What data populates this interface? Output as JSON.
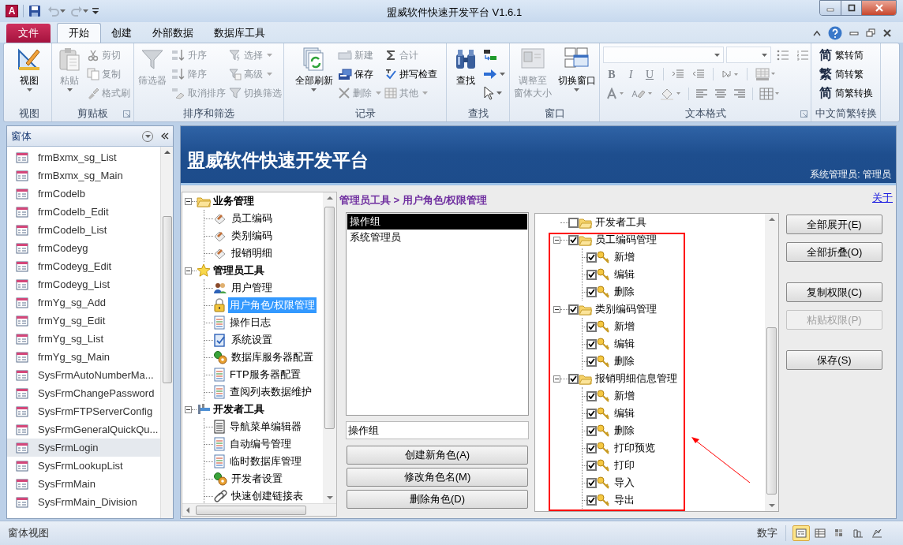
{
  "window": {
    "app_logo": "A",
    "title": "盟威软件快速开发平台 V1.6.1"
  },
  "ribbon_tabs": [
    {
      "label": "文件",
      "kind": "file",
      "selected": false
    },
    {
      "label": "开始",
      "kind": "tab",
      "selected": true
    },
    {
      "label": "创建",
      "kind": "tab",
      "selected": false
    },
    {
      "label": "外部数据",
      "kind": "tab",
      "selected": false
    },
    {
      "label": "数据库工具",
      "kind": "tab",
      "selected": false
    }
  ],
  "ribbon_groups": [
    {
      "label": "视图",
      "columns": [
        [
          {
            "kind": "large",
            "label_lines": [
              "视图"
            ],
            "disabled": false,
            "dropdown": true
          }
        ]
      ]
    },
    {
      "label": "剪贴板",
      "launcher": true,
      "columns": [
        [
          {
            "kind": "large",
            "label_lines": [
              "粘贴"
            ],
            "disabled": true,
            "dropdown": true
          }
        ],
        [
          {
            "kind": "small",
            "label": "剪切",
            "disabled": true
          },
          {
            "kind": "small",
            "label": "复制",
            "disabled": true
          },
          {
            "kind": "small",
            "label": "格式刷",
            "disabled": true
          }
        ]
      ]
    },
    {
      "label": "排序和筛选",
      "columns": [
        [
          {
            "kind": "large",
            "label_lines": [
              "筛选器"
            ],
            "disabled": true
          }
        ],
        [
          {
            "kind": "small",
            "label": "升序",
            "disabled": true
          },
          {
            "kind": "small",
            "label": "降序",
            "disabled": true
          },
          {
            "kind": "small",
            "label": "取消排序",
            "disabled": true
          }
        ],
        [
          {
            "kind": "small",
            "label": "选择",
            "disabled": true,
            "dropdown": true
          },
          {
            "kind": "small",
            "label": "高级",
            "disabled": true,
            "dropdown": true
          },
          {
            "kind": "small",
            "label": "切换筛选",
            "disabled": true
          }
        ]
      ]
    },
    {
      "label": "记录",
      "columns": [
        [
          {
            "kind": "large",
            "label_lines": [
              "全部刷新"
            ],
            "disabled": false,
            "dropdown": true
          }
        ],
        [
          {
            "kind": "small",
            "label": "新建",
            "disabled": true
          },
          {
            "kind": "small",
            "label": "保存",
            "disabled": false
          },
          {
            "kind": "small",
            "label": "删除",
            "disabled": true,
            "dropdown": true
          }
        ],
        [
          {
            "kind": "small",
            "label": "合计",
            "disabled": true
          },
          {
            "kind": "small",
            "label": "拼写检查",
            "disabled": false
          },
          {
            "kind": "small",
            "label": "其他",
            "disabled": true,
            "dropdown": true
          }
        ]
      ]
    },
    {
      "label": "查找",
      "columns": [
        [
          {
            "kind": "large",
            "label_lines": [
              "查找"
            ],
            "disabled": false
          }
        ],
        [
          {
            "kind": "icon",
            "disabled": false
          },
          {
            "kind": "icon",
            "disabled": false,
            "dropdown": true
          },
          {
            "kind": "icon",
            "disabled": false,
            "dropdown": true
          }
        ]
      ]
    },
    {
      "label": "窗口",
      "columns": [
        [
          {
            "kind": "large",
            "label_lines": [
              "调整至",
              "窗体大小"
            ],
            "disabled": true
          }
        ],
        [
          {
            "kind": "large",
            "label_lines": [
              "切换窗口"
            ],
            "disabled": false,
            "dropdown": true
          }
        ]
      ]
    },
    {
      "label": "文本格式",
      "launcher": true,
      "kind": "text_format",
      "glyphs": [
        "B",
        "I",
        "U"
      ]
    },
    {
      "label": "中文简繁转换",
      "columns": [
        [
          {
            "kind": "glyph",
            "glyph": "简",
            "label": "繁转简",
            "disabled": false
          },
          {
            "kind": "glyph",
            "glyph": "繁",
            "label": "简转繁",
            "disabled": false
          },
          {
            "kind": "glyph",
            "glyph": "简",
            "label": "简繁转换",
            "disabled": false
          }
        ]
      ]
    }
  ],
  "navigation_pane": {
    "title": "窗体",
    "items": [
      {
        "label": "frmBxmx_sg_List",
        "selected": false
      },
      {
        "label": "frmBxmx_sg_Main",
        "selected": false
      },
      {
        "label": "frmCodelb",
        "selected": false
      },
      {
        "label": "frmCodelb_Edit",
        "selected": false
      },
      {
        "label": "frmCodelb_List",
        "selected": false
      },
      {
        "label": "frmCodeyg",
        "selected": false
      },
      {
        "label": "frmCodeyg_Edit",
        "selected": false
      },
      {
        "label": "frmCodeyg_List",
        "selected": false
      },
      {
        "label": "frmYg_sg_Add",
        "selected": false
      },
      {
        "label": "frmYg_sg_Edit",
        "selected": false
      },
      {
        "label": "frmYg_sg_List",
        "selected": false
      },
      {
        "label": "frmYg_sg_Main",
        "selected": false
      },
      {
        "label": "SysFrmAutoNumberMa...",
        "selected": false
      },
      {
        "label": "SysFrmChangePassword",
        "selected": false
      },
      {
        "label": "SysFrmFTPServerConfig",
        "selected": false
      },
      {
        "label": "SysFrmGeneralQuickQu...",
        "selected": false
      },
      {
        "label": "SysFrmLogin",
        "selected": true
      },
      {
        "label": "SysFrmLookupList",
        "selected": false
      },
      {
        "label": "SysFrmMain",
        "selected": false
      },
      {
        "label": "SysFrmMain_Division",
        "selected": false
      }
    ]
  },
  "form_header": {
    "title": "盟威软件快速开发平台",
    "user": "系统管理员: 管理员"
  },
  "about_link": "关于",
  "breadcrumb": "管理员工具 > 用户角色/权限管理",
  "menu_tree": [
    {
      "label": "业务管理",
      "expanded": true,
      "selected": false,
      "children": [
        {
          "label": "员工编码",
          "selected": false
        },
        {
          "label": "类别编码",
          "selected": false
        },
        {
          "label": "报销明细",
          "selected": false
        }
      ]
    },
    {
      "label": "管理员工具",
      "expanded": true,
      "selected": false,
      "children": [
        {
          "label": "用户管理",
          "selected": false
        },
        {
          "label": "用户角色/权限管理",
          "selected": true
        },
        {
          "label": "操作日志",
          "selected": false
        },
        {
          "label": "系统设置",
          "selected": false
        },
        {
          "label": "数据库服务器配置",
          "selected": false
        },
        {
          "label": "FTP服务器配置",
          "selected": false
        },
        {
          "label": "查阅列表数据维护",
          "selected": false
        }
      ]
    },
    {
      "label": "开发者工具",
      "expanded": true,
      "selected": false,
      "children": [
        {
          "label": "导航菜单编辑器",
          "selected": false
        },
        {
          "label": "自动编号管理",
          "selected": false
        },
        {
          "label": "临时数据库管理",
          "selected": false
        },
        {
          "label": "开发者设置",
          "selected": false
        },
        {
          "label": "快速创建链接表",
          "selected": false
        }
      ]
    }
  ],
  "roles": {
    "items": [
      {
        "label": "操作组",
        "selected": true
      },
      {
        "label": "系统管理员",
        "selected": false
      }
    ],
    "role_name": "操作组",
    "buttons": [
      "创建新角色(A)",
      "修改角色名(M)",
      "删除角色(D)"
    ]
  },
  "permission_tree": [
    {
      "label": "开发者工具",
      "checked": false
    },
    {
      "label": "员工编码管理",
      "checked": true,
      "expanded": true,
      "children": [
        {
          "label": "新增",
          "checked": true
        },
        {
          "label": "编辑",
          "checked": true
        },
        {
          "label": "删除",
          "checked": true
        }
      ]
    },
    {
      "label": "类别编码管理",
      "checked": true,
      "expanded": true,
      "children": [
        {
          "label": "新增",
          "checked": true
        },
        {
          "label": "编辑",
          "checked": true
        },
        {
          "label": "删除",
          "checked": true
        }
      ]
    },
    {
      "label": "报销明细信息管理",
      "checked": true,
      "expanded": true,
      "children": [
        {
          "label": "新增",
          "checked": true
        },
        {
          "label": "编辑",
          "checked": true
        },
        {
          "label": "删除",
          "checked": true
        },
        {
          "label": "打印预览",
          "checked": true
        },
        {
          "label": "打印",
          "checked": true
        },
        {
          "label": "导入",
          "checked": true
        },
        {
          "label": "导出",
          "checked": true
        }
      ]
    }
  ],
  "permission_buttons": [
    {
      "label": "全部展开(E)",
      "disabled": false
    },
    {
      "label": "全部折叠(O)",
      "disabled": false
    },
    {
      "label": "复制权限(C)",
      "disabled": false
    },
    {
      "label": "粘贴权限(P)",
      "disabled": true
    },
    {
      "label": "保存(S)",
      "disabled": false
    }
  ],
  "status_bar": {
    "left": "窗体视图",
    "right": "数字",
    "views": [
      {
        "selected": true
      },
      {
        "selected": false
      },
      {
        "selected": false
      },
      {
        "selected": false
      },
      {
        "selected": false
      }
    ]
  }
}
